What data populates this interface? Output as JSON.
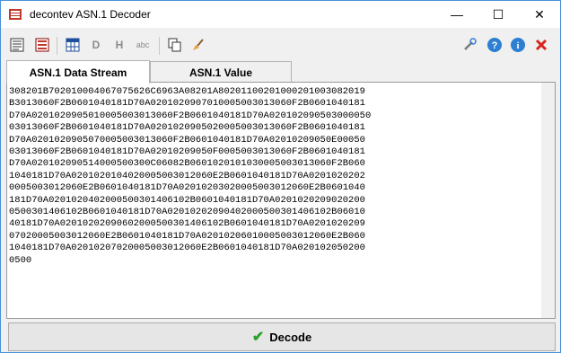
{
  "window": {
    "title": "decontev ASN.1 Decoder"
  },
  "titlebar_controls": {
    "minimize": "—",
    "maximize": "☐",
    "close": "✕"
  },
  "toolbar": {
    "left_icons": [
      "view-text-icon",
      "view-list-icon",
      "grid-icon",
      "decimal-icon",
      "hex-icon",
      "abc-icon",
      "copy-icon",
      "clear-brush-icon"
    ],
    "right_icons": [
      "settings-wrench-icon",
      "help-icon",
      "info-icon",
      "exit-icon"
    ],
    "labels": {
      "decimal": "D",
      "hex": "H",
      "abc": "abc"
    }
  },
  "tabs": [
    {
      "label": "ASN.1 Data Stream",
      "active": true
    },
    {
      "label": "ASN.1 Value",
      "active": false
    }
  ],
  "stream": {
    "lines": [
      "308201B70201000406707562 6C6963A08201A80201100201000201003082019",
      "B3013060F2B0601040181D70A0201020907010005003013060F2B0601040181",
      "D70A020102090501000500 3013060F2B0601040181D70A020102090503000050",
      "03013060F2B0601040181D70A0201020905020005003013060F2B0601040181",
      "D70A020102090507000500 3013060F2B0601040181D70A0201020905 0E00050",
      "03013060F2B0601040181D70A020102090 50F0005003013060F2B0601040181",
      "D70A020102090514000500300C06082B06010201010300050030 13060F2B060",
      "1040181D70A020102010402 000500301 2060E2B0601040181D70A0201020202",
      "0005003012060E2B0601040181D70A0201020302000500301 2060E2B0601040",
      "181D70A020102040 2000500301406102B0601040181D70A02010202090202 00",
      "0500301406102B0601040181D70A020102 0209040200050030 1406102B06010",
      "40181D70A0201020209060200050030 1406102B0601040181D70A0201020209",
      "07020005003012060E2B0601040181D70A020102 06010005003012060E2B060",
      "1040181D70A0201020702000500301 2060E2B0601040181D70A020102050200",
      "0500"
    ]
  },
  "decode_button": {
    "label": "Decode"
  }
}
